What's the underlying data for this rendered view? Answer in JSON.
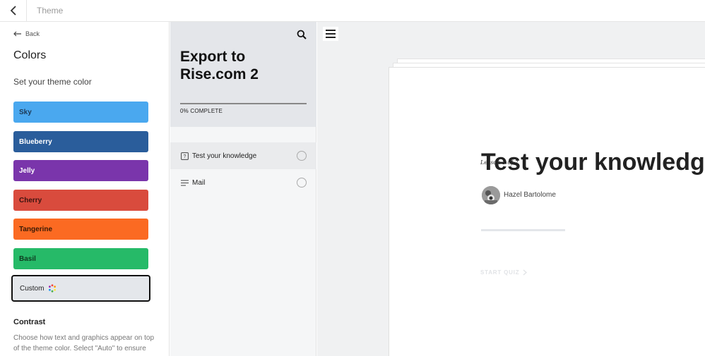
{
  "topbar": {
    "title": "Theme"
  },
  "panel": {
    "back_label": "Back",
    "title": "Colors",
    "subtitle": "Set your theme color",
    "swatches": [
      {
        "label": "Sky",
        "color": "#4aa8ef",
        "text_color": "#1d3a57"
      },
      {
        "label": "Blueberry",
        "color": "#2a5d9b",
        "text_color": "#ffffff"
      },
      {
        "label": "Jelly",
        "color": "#7a35ab",
        "text_color": "#ffffff"
      },
      {
        "label": "Cherry",
        "color": "#d94b3d",
        "text_color": "#3a1410"
      },
      {
        "label": "Tangerine",
        "color": "#fb6a22",
        "text_color": "#3a1a06"
      },
      {
        "label": "Basil",
        "color": "#26ba68",
        "text_color": "#0f3a20"
      },
      {
        "label": "Custom",
        "color": "#e4e7eb",
        "text_color": "#222222"
      }
    ],
    "contrast_title": "Contrast",
    "contrast_text": "Choose how text and graphics appear on top of the theme color. Select \"Auto\" to ensure"
  },
  "outline": {
    "course_title": "Export to Rise.com 2",
    "progress_text": "0% COMPLETE",
    "lessons": [
      {
        "label": "Test your knowledge",
        "icon": "quiz-icon",
        "progress": 0
      },
      {
        "label": "Mail",
        "icon": "text-lines-icon",
        "progress": 0
      }
    ]
  },
  "preview": {
    "lesson_count": "Lesson 1 of 2",
    "lesson_title": "Test your knowledge",
    "author": "Hazel Bartolome",
    "start_label": "START QUIZ"
  },
  "colors": {
    "accent_dark": "#111111",
    "sidebar_header": "#e4e6ea",
    "preview_bg": "#f0f1f2"
  }
}
